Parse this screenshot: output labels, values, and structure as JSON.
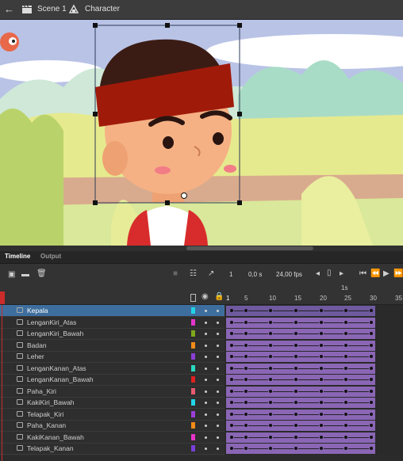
{
  "breadcrumb": {
    "scene": "Scene 1",
    "symbol": "Character"
  },
  "panel_tabs": [
    "Timeline",
    "Output"
  ],
  "toolbar": {
    "frame": "1",
    "time": "0,0 s",
    "fps": "24,00 fps"
  },
  "ruler": {
    "seconds_label": "1s",
    "marks": [
      "1",
      "5",
      "10",
      "15",
      "20",
      "25",
      "30",
      "35"
    ]
  },
  "layers": [
    {
      "name": "Kepala",
      "color": "#22d3e6",
      "selected": true
    },
    {
      "name": "LenganKiri_Atas",
      "color": "#e535c9"
    },
    {
      "name": "LenganKiri_Bawah",
      "color": "#7ea81c"
    },
    {
      "name": "Badan",
      "color": "#f08b1a"
    },
    {
      "name": "Leher",
      "color": "#8a3fd6"
    },
    {
      "name": "LenganKanan_Atas",
      "color": "#2ad7c0"
    },
    {
      "name": "LenganKanan_Bawah",
      "color": "#e02020"
    },
    {
      "name": "Paha_Kiri",
      "color": "#e85a6e"
    },
    {
      "name": "KakiKiri_Bawah",
      "color": "#22d3e6"
    },
    {
      "name": "Telapak_Kiri",
      "color": "#9b3fd6"
    },
    {
      "name": "Paha_Kanan",
      "color": "#f08b1a"
    },
    {
      "name": "KakiKanan_Bawah",
      "color": "#e535c9"
    },
    {
      "name": "Telapak_Kanan",
      "color": "#7a3fd6"
    }
  ],
  "colors": {
    "frame_span": "#8a66b5",
    "selected_layer": "#3e6e9e",
    "playhead": "#cc2b2b"
  }
}
